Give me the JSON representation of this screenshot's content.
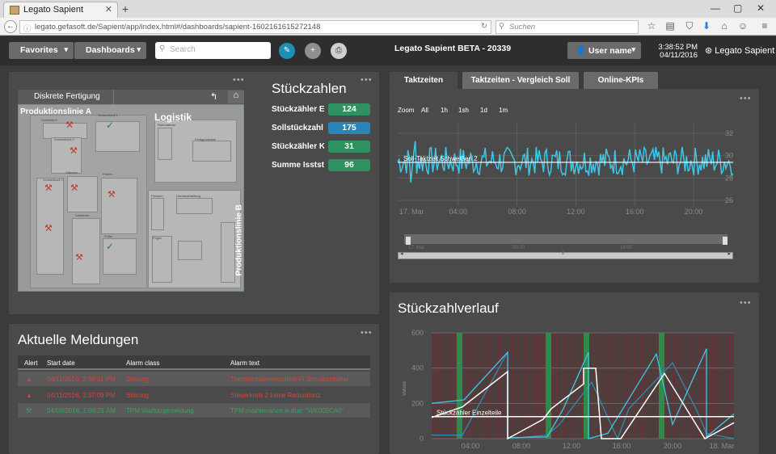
{
  "browser": {
    "tab_title": "Legato Sapient",
    "url": "legato.gefasoft.de/Sapient/app/index.html#/dashboards/sapient-1602161615272148",
    "search_placeholder": "Suchen",
    "win_min": "—",
    "win_max": "▢",
    "win_close": "✕"
  },
  "header": {
    "favorites": "Favorites",
    "dashboards": "Dashboards",
    "search_placeholder": "Search",
    "title": "Legato Sapient BETA - 20339",
    "user": "User name",
    "time": "3:38:52 PM",
    "date": "04/11/2016",
    "brand": "Legato Sapient"
  },
  "map_panel": {
    "dropdown": "Diskrete Fertigung",
    "line_a": "Produktionslinie A",
    "line_b": "Produktionslinie B",
    "logistik": "Logistik",
    "small_labels": [
      "Schweißen",
      "Schweißzell 1",
      "Schweißzell 2",
      "Glänzen",
      "Schweißzell 3",
      "Prüfen",
      "Lackieren",
      "Puffer",
      "Rohmaterial",
      "Fertigprodukte",
      "Pressen",
      "Drehbearbeitung",
      "Fügen"
    ]
  },
  "stueckzahlen": {
    "title": "Stückzahlen",
    "rows": [
      {
        "label": "Stückzähler E...",
        "value": "124",
        "color": "#2e9160"
      },
      {
        "label": "Sollstückzahl ...",
        "value": "175",
        "color": "#2a86b8"
      },
      {
        "label": "Stückzähler K...",
        "value": "31",
        "color": "#2e9160"
      },
      {
        "label": "Summe Isststü...",
        "value": "96",
        "color": "#2e9160"
      }
    ]
  },
  "meldungen": {
    "title": "Aktuelle Meldungen",
    "columns": [
      "Alert",
      "Start date",
      "Alarm class",
      "Alarm text"
    ],
    "rows": [
      {
        "start": "04/11/2016, 3:38:31 PM",
        "class": "Störung",
        "text": "Transformatorenstation FI Schutzschalter",
        "color": "#d9443a",
        "icon": "warning-icon"
      },
      {
        "start": "04/11/2016, 3:37:09 PM",
        "class": "Störung",
        "text": "Steuerkreis 2 keine Redundanz",
        "color": "#d9443a",
        "icon": "warning-icon"
      },
      {
        "start": "04/09/2016, 1:09:21 AM",
        "class": "TPM Wartungsmeldung",
        "text": "TPM maintenance is due: \"WK002CA0\"",
        "color": "#3aa063",
        "icon": "wrench-icon"
      }
    ]
  },
  "tabs": [
    "Taktzeiten",
    "Taktzeiten - Vergleich Soll",
    "Online-KPIs"
  ],
  "zoom": {
    "label": "Zoom",
    "options": [
      "All",
      "1h",
      "1sh",
      "1d",
      "1m"
    ]
  },
  "navigator_labels": [
    "17. Mar",
    "00:00",
    "18:00"
  ],
  "chart_data": [
    {
      "type": "line",
      "series": [
        {
          "name": "Soll-Taktzeit Schweißen 2",
          "constant": 29.4
        },
        {
          "values_note": "noisy cycle time around 29.5, range 27.5–31.3"
        }
      ],
      "x_ticks": [
        "17. Mar",
        "04:00",
        "08:00",
        "12:00",
        "16:00",
        "20:00"
      ],
      "y_ticks": [
        26,
        28,
        30,
        32
      ],
      "ylim": [
        25.5,
        33
      ]
    },
    {
      "type": "line",
      "title": "Stückzahlverlauf",
      "ylabel": "Values",
      "x_ticks": [
        "04:00",
        "08:00",
        "12:00",
        "16:00",
        "20:00",
        "18. Mar"
      ],
      "y_ticks": [
        0,
        200,
        400,
        600
      ],
      "ylim": [
        0,
        600
      ],
      "series": [
        {
          "name": "Stückzähler Einzelteile",
          "constant": 125
        }
      ]
    }
  ]
}
